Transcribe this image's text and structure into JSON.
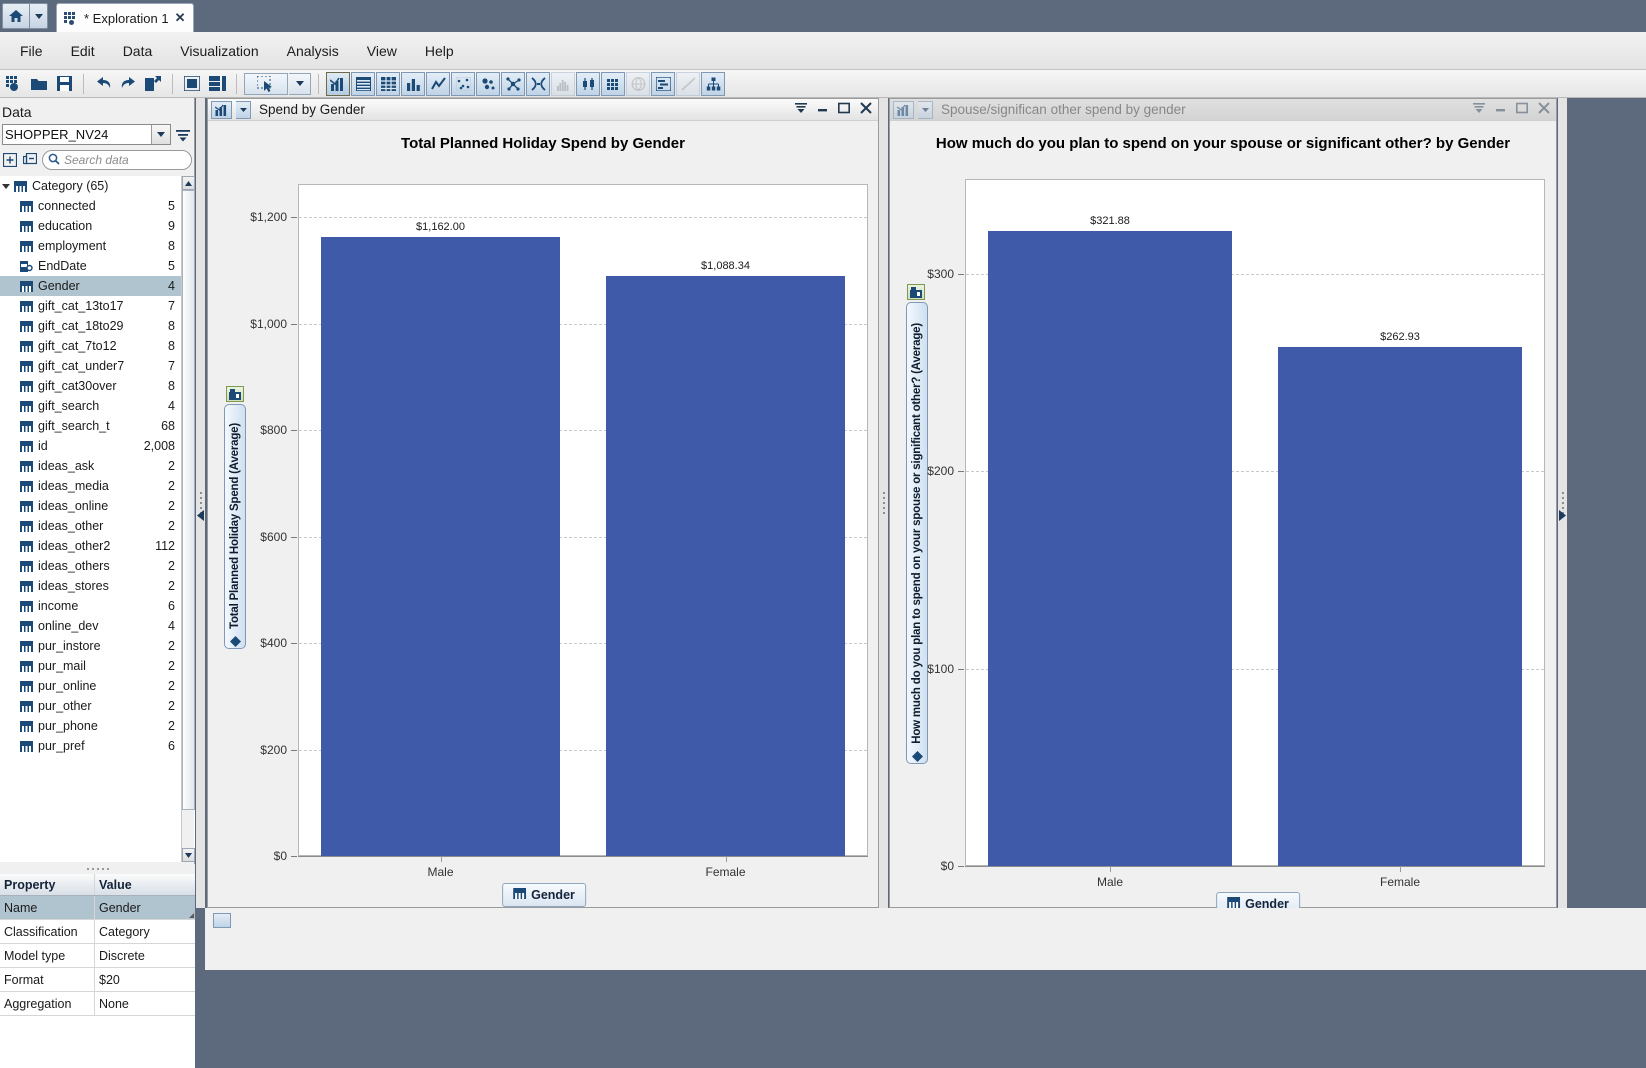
{
  "window": {
    "home_button": "home-icon",
    "tab_label": "* Exploration 1",
    "tab_close": "✕"
  },
  "menubar": {
    "items": [
      "File",
      "Edit",
      "Data",
      "Visualization",
      "Analysis",
      "View",
      "Help"
    ]
  },
  "toolbar": {
    "groups": [
      [
        "new-exploration-icon",
        "open-icon",
        "save-icon"
      ],
      [
        "undo-icon",
        "redo-icon",
        "export-icon"
      ],
      [
        "single-layout-icon",
        "stacked-layout-icon"
      ],
      [
        "select-tool-icon",
        "select-tool-dropdown-icon"
      ],
      [
        "auto-chart-icon",
        "table-icon",
        "crosstab-icon",
        "bar-chart-icon",
        "line-chart-icon",
        "scatter-matrix-icon",
        "bubble-plot-icon",
        "network-icon",
        "needle-icon",
        "histogram-icon",
        "box-plot-icon",
        "heat-map-icon",
        "geo-map-icon",
        "schedule-chart-icon",
        "fit-line-icon",
        "treemap-icon"
      ]
    ]
  },
  "data_panel": {
    "title": "Data",
    "source": "SHOPPER_NV24",
    "search_placeholder": "Search data",
    "expand_icon": "expand-all-icon",
    "collapse_icon": "collapse-all-icon",
    "menu_icon": "data-menu-icon",
    "group": {
      "label": "Category (65)",
      "icon": "category-icon"
    },
    "items": [
      {
        "name": "connected",
        "count": "5",
        "icon": "category-icon"
      },
      {
        "name": "education",
        "count": "9",
        "icon": "category-icon"
      },
      {
        "name": "employment",
        "count": "8",
        "icon": "category-icon"
      },
      {
        "name": "EndDate",
        "count": "5",
        "icon": "date-icon"
      },
      {
        "name": "Gender",
        "count": "4",
        "icon": "category-icon",
        "selected": true
      },
      {
        "name": "gift_cat_13to17",
        "count": "7",
        "icon": "category-icon"
      },
      {
        "name": "gift_cat_18to29",
        "count": "8",
        "icon": "category-icon"
      },
      {
        "name": "gift_cat_7to12",
        "count": "8",
        "icon": "category-icon"
      },
      {
        "name": "gift_cat_under7",
        "count": "7",
        "icon": "category-icon"
      },
      {
        "name": "gift_cat30over",
        "count": "8",
        "icon": "category-icon"
      },
      {
        "name": "gift_search",
        "count": "4",
        "icon": "category-icon"
      },
      {
        "name": "gift_search_t",
        "count": "68",
        "icon": "category-icon"
      },
      {
        "name": "id",
        "count": "2,008",
        "icon": "category-icon"
      },
      {
        "name": "ideas_ask",
        "count": "2",
        "icon": "category-icon"
      },
      {
        "name": "ideas_media",
        "count": "2",
        "icon": "category-icon"
      },
      {
        "name": "ideas_online",
        "count": "2",
        "icon": "category-icon"
      },
      {
        "name": "ideas_other",
        "count": "2",
        "icon": "category-icon"
      },
      {
        "name": "ideas_other2",
        "count": "112",
        "icon": "category-icon"
      },
      {
        "name": "ideas_others",
        "count": "2",
        "icon": "category-icon"
      },
      {
        "name": "ideas_stores",
        "count": "2",
        "icon": "category-icon"
      },
      {
        "name": "income",
        "count": "6",
        "icon": "category-icon"
      },
      {
        "name": "online_dev",
        "count": "4",
        "icon": "category-icon"
      },
      {
        "name": "pur_instore",
        "count": "2",
        "icon": "category-icon"
      },
      {
        "name": "pur_mail",
        "count": "2",
        "icon": "category-icon"
      },
      {
        "name": "pur_online",
        "count": "2",
        "icon": "category-icon"
      },
      {
        "name": "pur_other",
        "count": "2",
        "icon": "category-icon"
      },
      {
        "name": "pur_phone",
        "count": "2",
        "icon": "category-icon"
      },
      {
        "name": "pur_pref",
        "count": "6",
        "icon": "category-icon"
      }
    ]
  },
  "properties": {
    "col_property": "Property",
    "col_value": "Value",
    "rows": [
      {
        "property": "Name",
        "value": "Gender",
        "selected": true
      },
      {
        "property": "Classification",
        "value": "Category"
      },
      {
        "property": "Model type",
        "value": "Discrete"
      },
      {
        "property": "Format",
        "value": "$20"
      },
      {
        "property": "Aggregation",
        "value": "None"
      }
    ]
  },
  "panels": [
    {
      "header_title": "Spend by Gender",
      "header_icon": "bar-chart-icon",
      "header_dropdown_icon": "chevron-down-icon",
      "controls": [
        "panel-menu-icon",
        "minimize-icon",
        "maximize-icon",
        "close-icon"
      ],
      "active": true,
      "legend_label": "Gender",
      "legend_icon": "category-icon"
    },
    {
      "header_title": "Spouse/significan other spend by gender",
      "header_icon": "bar-chart-icon",
      "header_dropdown_icon": "chevron-down-icon",
      "controls": [
        "panel-menu-icon",
        "minimize-icon",
        "maximize-icon",
        "close-icon"
      ],
      "active": false,
      "legend_label": "Gender",
      "legend_icon": "category-icon"
    }
  ],
  "chart_data": [
    {
      "type": "bar",
      "title": "Total Planned Holiday Spend by Gender",
      "xlabel": "Gender",
      "ylabel": "Total Planned Holiday Spend (Average)",
      "categories": [
        "Male",
        "Female"
      ],
      "values": [
        1162.0,
        1088.34
      ],
      "data_labels": [
        "$1,162.00",
        "$1,088.34"
      ],
      "ylim": [
        0,
        1262
      ],
      "yticks": [
        0,
        200,
        400,
        600,
        800,
        1000,
        1200
      ],
      "ytick_labels": [
        "$0",
        "$200",
        "$400",
        "$600",
        "$800",
        "$1,000",
        "$1,200"
      ],
      "grid": true,
      "bar_color": "#3f5aa9",
      "legend_position": "bottom"
    },
    {
      "type": "bar",
      "title": "How much do you plan to spend on your spouse or significant other? by Gender",
      "xlabel": "Gender",
      "ylabel": "How much do you plan to spend on your spouse or significant other? (Average)",
      "categories": [
        "Male",
        "Female"
      ],
      "values": [
        321.88,
        262.93
      ],
      "data_labels": [
        "$321.88",
        "$262.93"
      ],
      "ylim": [
        0,
        348
      ],
      "yticks": [
        0,
        100,
        200,
        300
      ],
      "ytick_labels": [
        "$0",
        "$100",
        "$200",
        "$300"
      ],
      "grid": true,
      "bar_color": "#3f5aa9",
      "legend_position": "bottom"
    }
  ]
}
